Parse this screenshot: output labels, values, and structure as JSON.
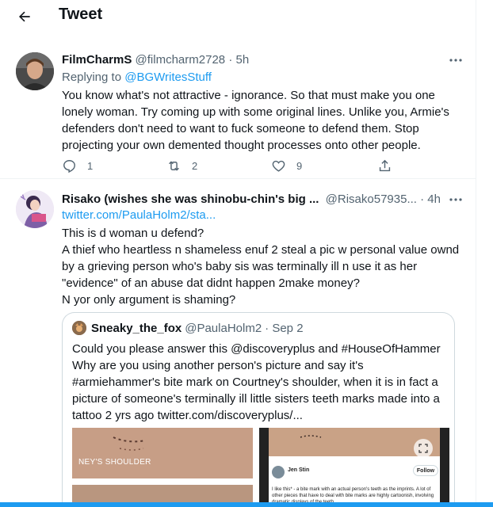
{
  "header": {
    "title": "Tweet"
  },
  "tweets": [
    {
      "name": "FilmCharmS",
      "handle": "@filmcharm2728",
      "time": "· 5h",
      "reply_prefix": "Replying to",
      "reply_to": "@BGWritesStuff",
      "text": "You know what's not attractive - ignorance. So that must make you one lonely woman. Try coming up with some original lines. Unlike you, Armie's defenders don't need to want to fuck someone to defend them. Stop projecting your own demented thought processes onto other people.",
      "replies": "1",
      "retweets": "2",
      "likes": "9"
    },
    {
      "name": "Risako (wishes she was shinobu-chin's big ...",
      "handle": "@Risako57935...",
      "time": "· 4h",
      "link": "twitter.com/PaulaHolm2/sta...",
      "lines": [
        "This is d woman u defend?",
        "A thief who heartless n shameless enuf 2 steal a pic w personal value ownd by a grieving person who's baby sis was terminally ill n use it as her \"evidence\" of an abuse dat didnt happen 2make money?",
        "N yor only argument is shaming?"
      ],
      "quote": {
        "name": "Sneaky_the_fox",
        "handle": "@PaulaHolm2",
        "time": "· Sep 2",
        "text": "Could you please answer this @discoveryplus and #HouseOfHammer Why are you using another person's picture and say it's #armiehammer's bite mark on Courtney's shoulder, when it is in fact a picture of someone's terminally ill little sisters teeth marks made into a tattoo 2 yrs ago  twitter.com/discoveryplus/...",
        "media": {
          "left_label": "NEY'S SHOULDER",
          "card_name": "Jen Stin",
          "card_follow": "Follow",
          "card_text": "I like this* - a bite mark with an actual person's teeth as the imprints. A lot of other pieces that have to deal with bite marks are highly cartoonish, involving dramatic displays of the teeth."
        }
      }
    }
  ],
  "colors": {
    "accent": "#1d9bf0",
    "secondary_text": "#536471",
    "border": "#eff3f4"
  }
}
